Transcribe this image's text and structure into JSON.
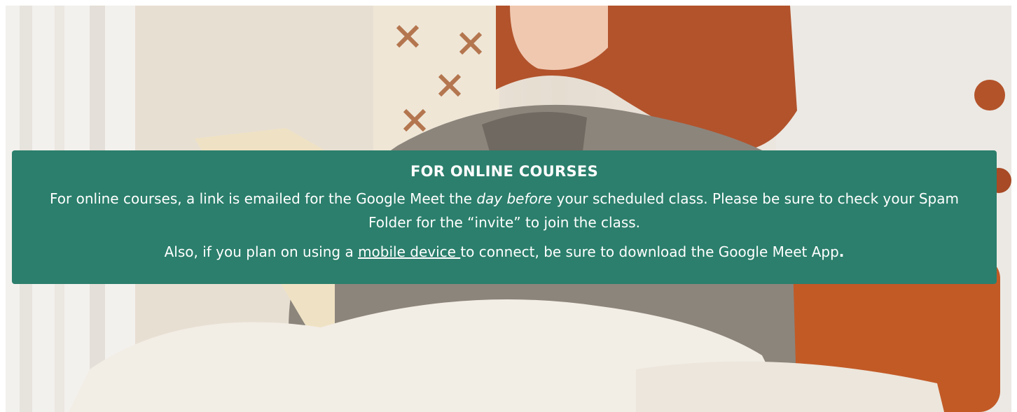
{
  "banner": {
    "title": "FOR ONLINE COURSES",
    "para1": {
      "before": "For online courses, a link is emailed for the Google Meet the ",
      "emphasis": "day before",
      "after": " your scheduled class. Please be sure to check your Spam Folder for the “invite” to join the class."
    },
    "para2": {
      "before": "Also, if you plan on using a ",
      "link_text": "mobile device ",
      "after": "to connect, be sure to download the Google Meet App",
      "end": "."
    },
    "background_color": "#2b7f6c",
    "text_color": "#ffffff"
  },
  "hero_image": {
    "description_icon": "woman-reading-photo"
  }
}
